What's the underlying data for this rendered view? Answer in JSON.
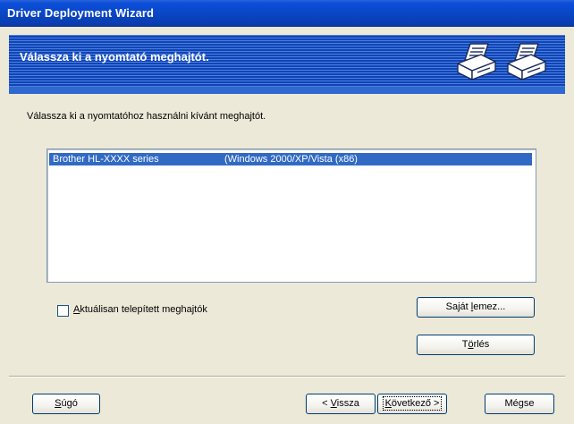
{
  "window": {
    "title": "Driver Deployment Wizard"
  },
  "banner": {
    "heading": "Válassza ki a nyomtató meghajtót.",
    "icons": [
      "printer-icon",
      "printer-icon"
    ]
  },
  "content": {
    "instruction": "Válassza ki a nyomtatóhoz használni kívánt meghajtót.",
    "driver_list": [
      {
        "name": "Brother HL-XXXX series",
        "platform": "(Windows 2000/XP/Vista (x86)",
        "selected": true
      }
    ],
    "checkbox": {
      "label_underlined": "A",
      "label_rest": "ktuálisan telepített meghajtók",
      "checked": false
    }
  },
  "buttons": {
    "have_disk_pre": "Saját ",
    "have_disk_u": "l",
    "have_disk_post": "emez...",
    "delete_pre": "T",
    "delete_u": "ö",
    "delete_post": "rlés",
    "help_u": "S",
    "help_post": "úgó",
    "back_pre": "< ",
    "back_u": "V",
    "back_post": "issza",
    "next_u": "K",
    "next_post": "övetkező >",
    "cancel": "Mégse"
  },
  "colors": {
    "titlebar": "#0a46c6",
    "banner": "#1145b5",
    "selection": "#316ac5",
    "dialog_bg": "#ece9d8"
  }
}
